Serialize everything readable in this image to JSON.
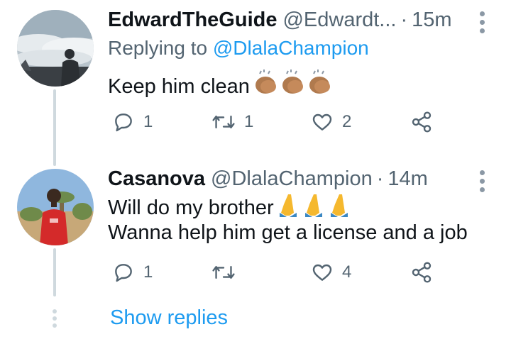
{
  "tweets": [
    {
      "name": "EdwardTheGuide",
      "handle": "@Edwardt...",
      "separator": "·",
      "time": "15m",
      "replying_prefix": "Replying to",
      "replying_to": "@DlalaChampion",
      "lines": [
        "Keep him clean"
      ],
      "emoji_line": "clapping-hands-emoji x3",
      "replies": "1",
      "retweets": "1",
      "likes": "2",
      "avatar": "cloud-sea-person-avatar"
    },
    {
      "name": "Casanova",
      "handle": "@DlalaChampion",
      "separator": "·",
      "time": "14m",
      "lines": [
        "Will do my brother",
        "Wanna help him get a license and a job"
      ],
      "emoji_line": "folded-hands-emoji x3",
      "replies": "1",
      "retweets": "",
      "likes": "4",
      "avatar": "person-red-shirt-avatar"
    }
  ],
  "show_replies_label": "Show replies",
  "colors": {
    "link": "#1d9bf0",
    "secondary": "#536471",
    "text": "#0f1419",
    "thread_line": "#cfd9de"
  }
}
